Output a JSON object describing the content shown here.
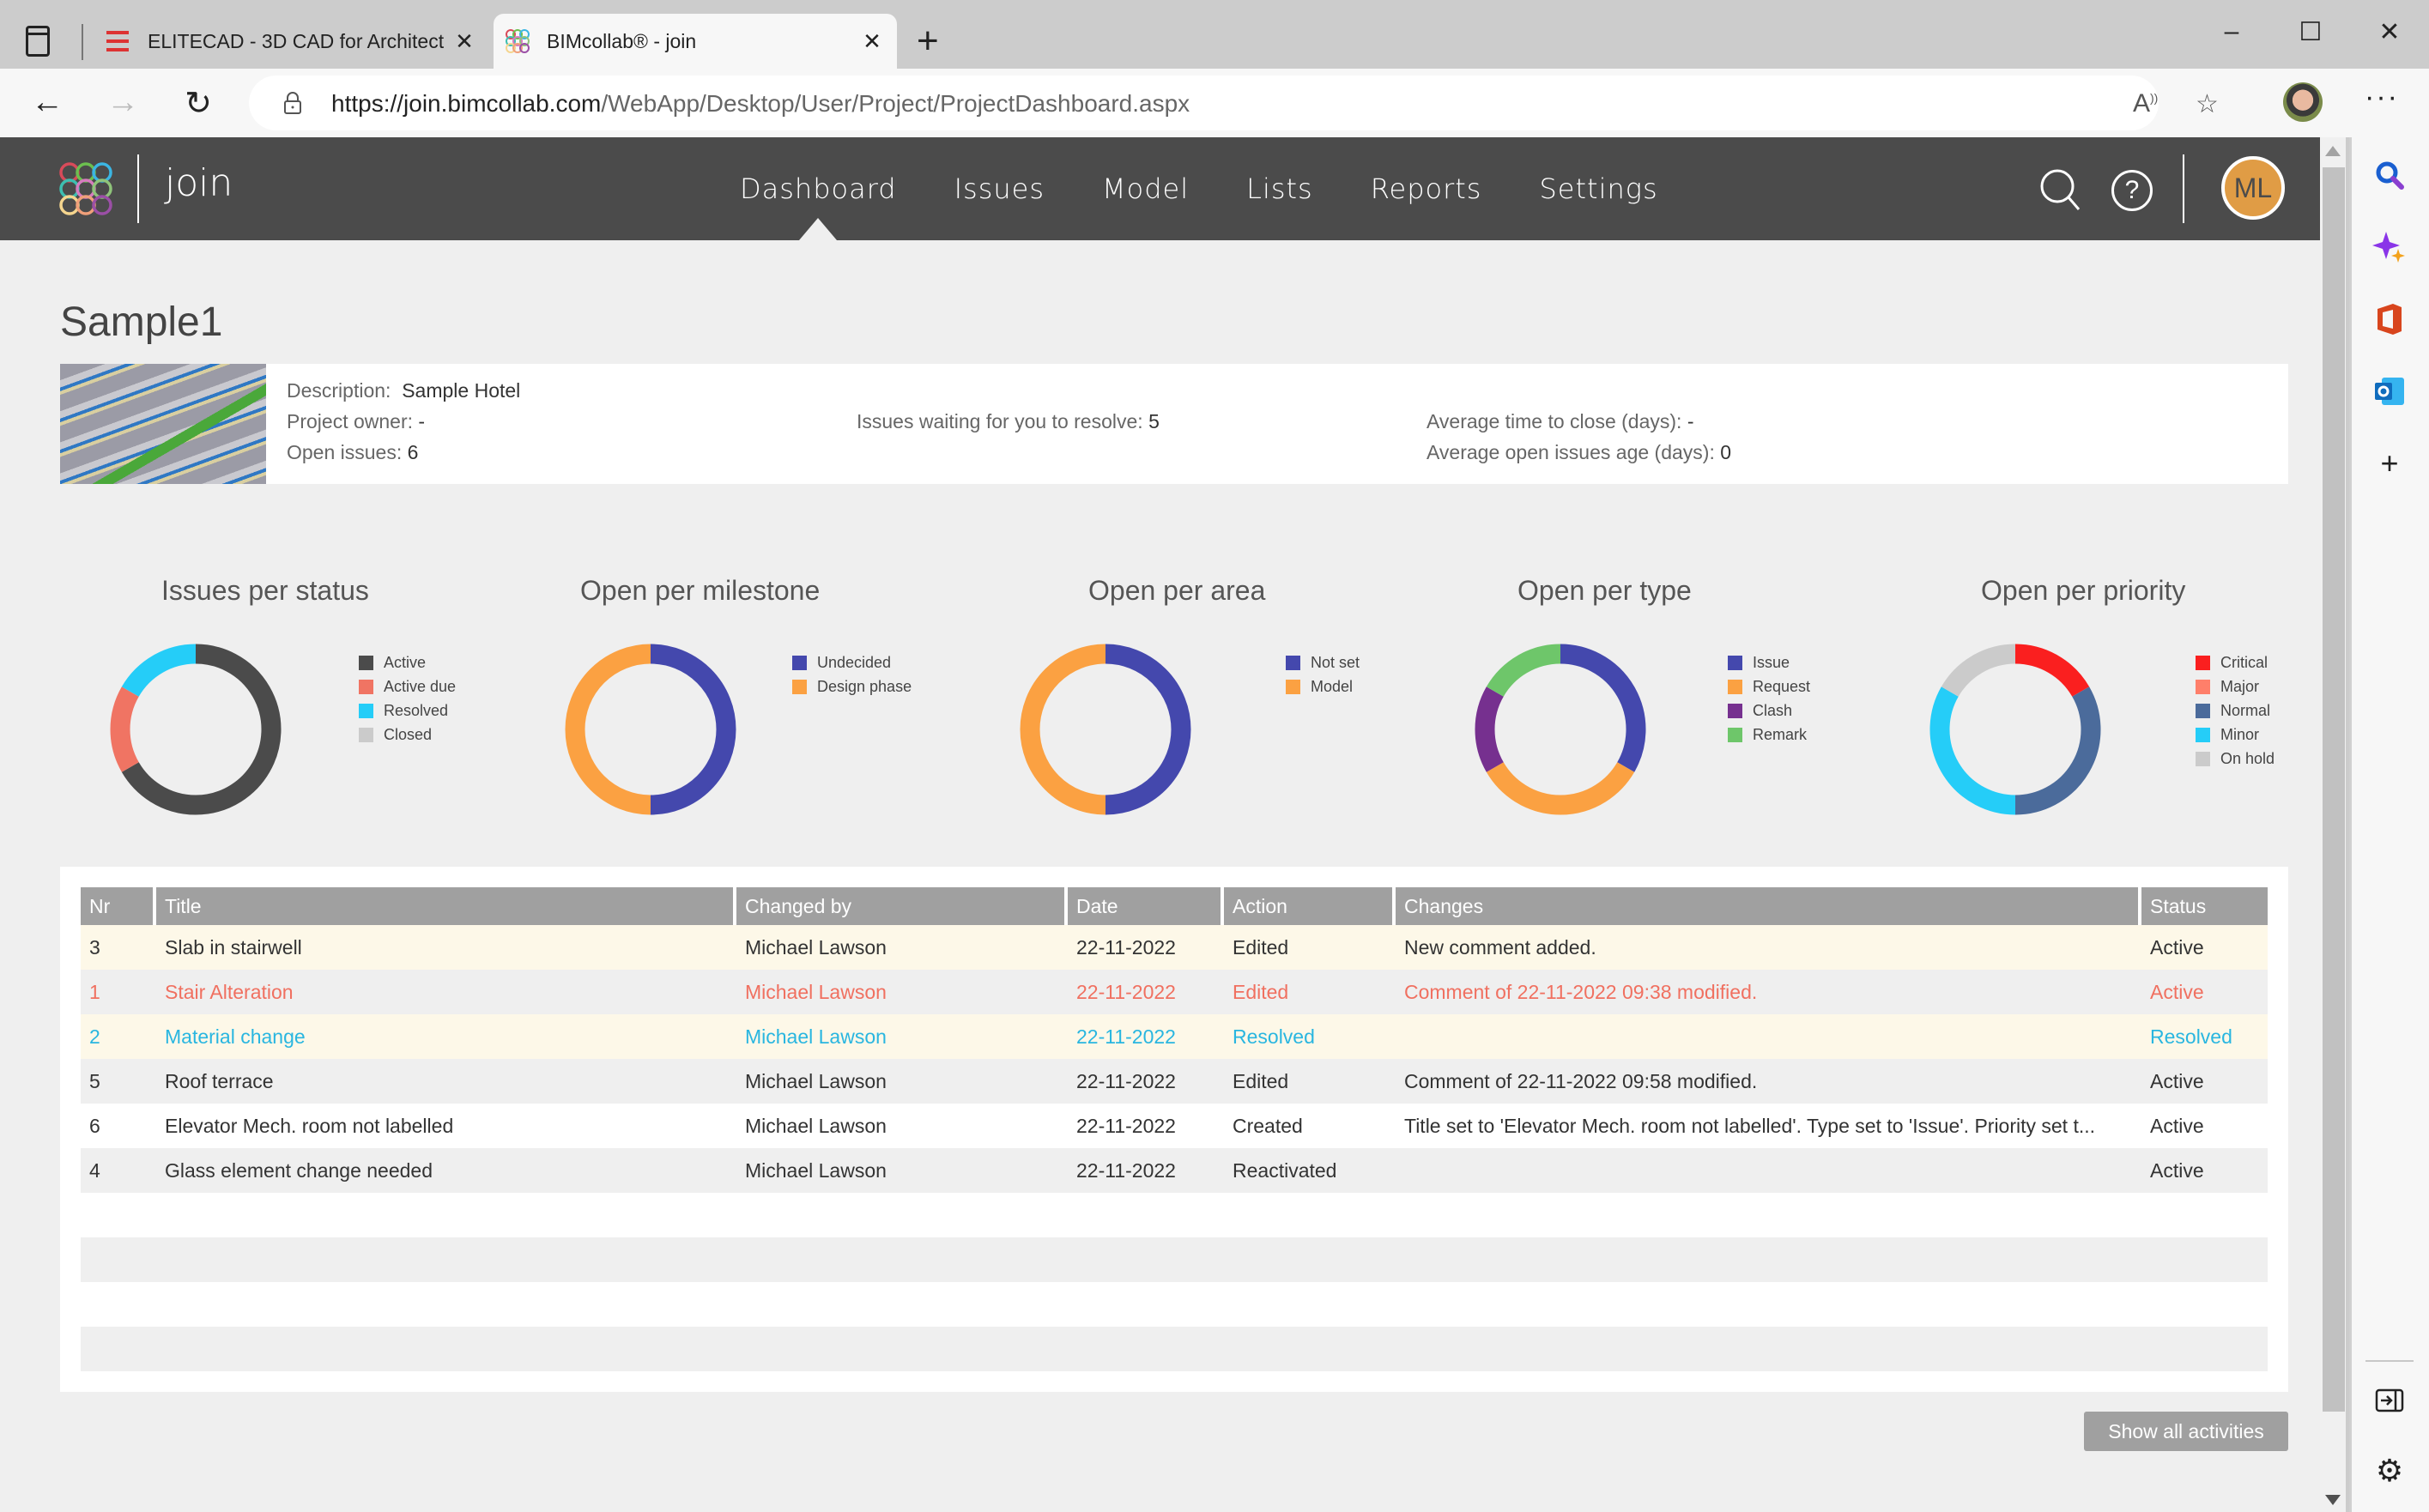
{
  "browser": {
    "tabs": [
      {
        "label": "ELITECAD - 3D CAD for Architect",
        "active": false
      },
      {
        "label": "BIMcollab® - join",
        "active": true
      }
    ],
    "url_host": "https://join.bimcollab.com",
    "url_path": "/WebApp/Desktop/User/Project/ProjectDashboard.aspx",
    "window_controls": {
      "minimize": "–",
      "maximize": "☐",
      "close": "✕"
    }
  },
  "app": {
    "brand": "join",
    "nav": [
      "Dashboard",
      "Issues",
      "Model",
      "Lists",
      "Reports",
      "Settings"
    ],
    "active_nav": "Dashboard",
    "user_initials": "ML"
  },
  "project": {
    "title": "Sample1",
    "description_label": "Description:",
    "description": "Sample Hotel",
    "owner_label": "Project owner:",
    "owner": "-",
    "open_issues_label": "Open issues:",
    "open_issues": "6",
    "waiting_label": "Issues waiting for you to resolve:",
    "waiting": "5",
    "avg_close_label": "Average time to close (days):",
    "avg_close": "-",
    "avg_age_label": "Average open issues age (days):",
    "avg_age": "0"
  },
  "chart_data": [
    {
      "type": "pie",
      "title": "Issues per status",
      "legend_position": "right",
      "categories": [
        "Active",
        "Active due",
        "Resolved",
        "Closed"
      ],
      "values": [
        4,
        1,
        1,
        0
      ],
      "colors": [
        "#4b4b4b",
        "#f07463",
        "#25cdf8",
        "#cbcbcb"
      ]
    },
    {
      "type": "pie",
      "title": "Open per milestone",
      "legend_position": "right",
      "categories": [
        "Undecided",
        "Design phase"
      ],
      "values": [
        3,
        3
      ],
      "colors": [
        "#4448ad",
        "#fba142"
      ]
    },
    {
      "type": "pie",
      "title": "Open per area",
      "legend_position": "right",
      "categories": [
        "Not set",
        "Model"
      ],
      "values": [
        3,
        3
      ],
      "colors": [
        "#4448ad",
        "#fba142"
      ]
    },
    {
      "type": "pie",
      "title": "Open per type",
      "legend_position": "right",
      "categories": [
        "Issue",
        "Request",
        "Clash",
        "Remark"
      ],
      "values": [
        2,
        2,
        1,
        1
      ],
      "colors": [
        "#4448ad",
        "#fba142",
        "#76308f",
        "#6ec66a"
      ]
    },
    {
      "type": "pie",
      "title": "Open per priority",
      "legend_position": "right",
      "categories": [
        "Critical",
        "Major",
        "Normal",
        "Minor",
        "On hold"
      ],
      "values": [
        1,
        0,
        2,
        2,
        1
      ],
      "colors": [
        "#fa1f1f",
        "#ff7f6a",
        "#4b6b9b",
        "#25cdf8",
        "#cbcbcb"
      ]
    }
  ],
  "activities": {
    "columns": [
      "Nr",
      "Title",
      "Changed by",
      "Date",
      "Action",
      "Changes",
      "Status"
    ],
    "rows": [
      {
        "nr": "3",
        "title": "Slab in stairwell",
        "changed_by": "Michael Lawson",
        "date": "22-11-2022",
        "action": "Edited",
        "changes": "New comment added.",
        "status": "Active",
        "bg": "yellow",
        "color": ""
      },
      {
        "nr": "1",
        "title": "Stair Alteration",
        "changed_by": "Michael Lawson",
        "date": "22-11-2022",
        "action": "Edited",
        "changes": "Comment of 22-11-2022 09:38 modified.",
        "status": "Active",
        "bg": "grey",
        "color": "red"
      },
      {
        "nr": "2",
        "title": "Material change",
        "changed_by": "Michael Lawson",
        "date": "22-11-2022",
        "action": "Resolved",
        "changes": "",
        "status": "Resolved",
        "bg": "yellow",
        "color": "blue"
      },
      {
        "nr": "5",
        "title": "Roof terrace",
        "changed_by": "Michael Lawson",
        "date": "22-11-2022",
        "action": "Edited",
        "changes": "Comment of 22-11-2022 09:58 modified.",
        "status": "Active",
        "bg": "grey",
        "color": ""
      },
      {
        "nr": "6",
        "title": "Elevator Mech. room not labelled",
        "changed_by": "Michael Lawson",
        "date": "22-11-2022",
        "action": "Created",
        "changes": "Title set to 'Elevator Mech. room not labelled'. Type set to 'Issue'. Priority set t...",
        "status": "Active",
        "bg": "white",
        "color": ""
      },
      {
        "nr": "4",
        "title": "Glass element change needed",
        "changed_by": "Michael Lawson",
        "date": "22-11-2022",
        "action": "Reactivated",
        "changes": "",
        "status": "Active",
        "bg": "grey",
        "color": ""
      }
    ],
    "show_all_label": "Show all activities"
  },
  "edge_sidebar": [
    "search-icon",
    "copilot-icon",
    "office-icon",
    "outlook-icon",
    "add-icon",
    "sidebar-toggle-icon",
    "settings-icon"
  ]
}
